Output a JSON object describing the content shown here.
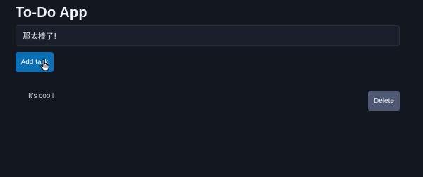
{
  "app": {
    "title": "To-Do App"
  },
  "input": {
    "value": "那太棒了!",
    "placeholder": ""
  },
  "add_button": {
    "label": "Add task"
  },
  "tasks": [
    {
      "text": "It's cool!",
      "delete_label": "Delete"
    }
  ],
  "colors": {
    "background": "#131720",
    "input_background": "#1a1f2b",
    "accent": "#0a6fb5",
    "delete_button": "#4f5872"
  },
  "icons": {
    "cursor": "hand-pointer-icon"
  }
}
